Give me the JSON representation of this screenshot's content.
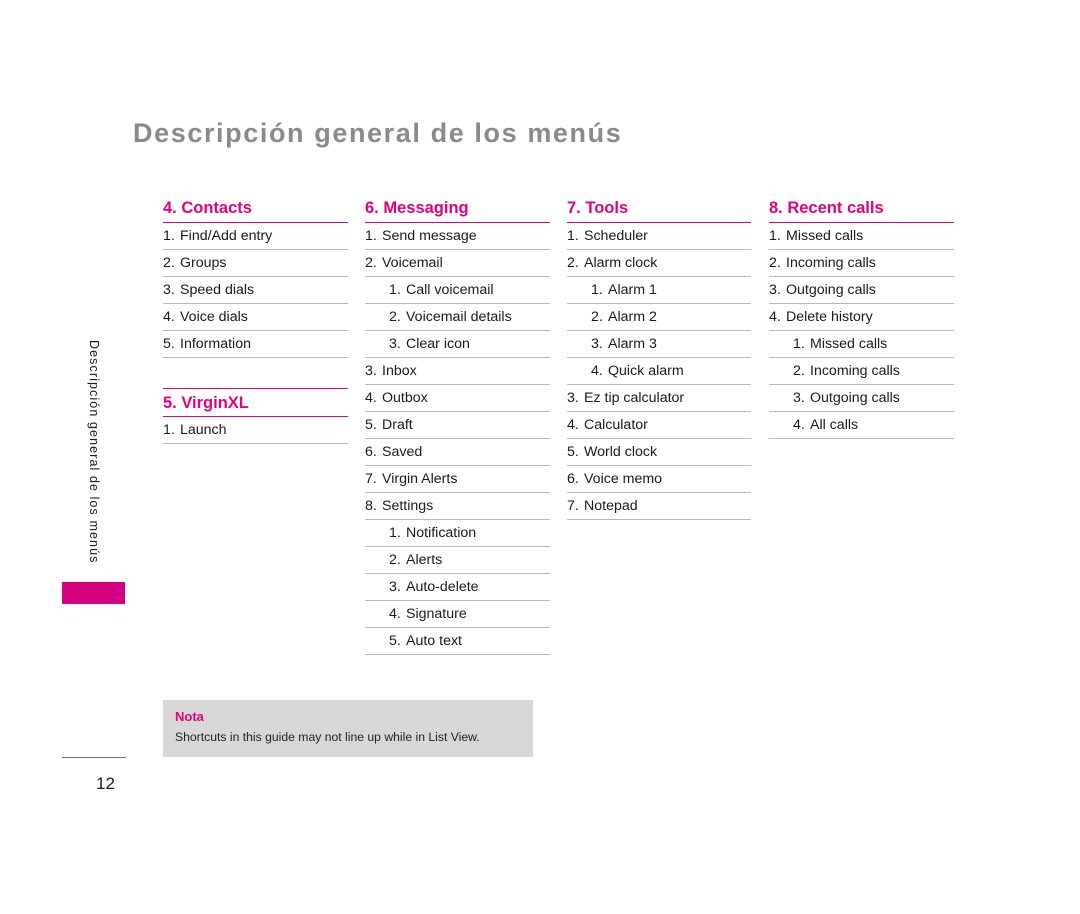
{
  "page": {
    "title": "Descripción general de los menús",
    "sidebar_label": "Descripción general de los menús",
    "page_number": "12",
    "accent_color": "#e4007f",
    "sidebar_block_color": "#d4007f",
    "title_color": "#8a8a8a",
    "rule_color": "#b9b9b9"
  },
  "columns": [
    {
      "sections": [
        {
          "heading": "4. Contacts",
          "top_rule": false,
          "items": [
            {
              "num": "1.",
              "text": "Find/Add entry",
              "level": 1
            },
            {
              "num": "2.",
              "text": "Groups",
              "level": 1
            },
            {
              "num": "3.",
              "text": "Speed dials",
              "level": 1
            },
            {
              "num": "4.",
              "text": "Voice dials",
              "level": 1
            },
            {
              "num": "5.",
              "text": "Information",
              "level": 1
            }
          ]
        },
        {
          "heading": "5. VirginXL",
          "top_rule": true,
          "items": [
            {
              "num": "1.",
              "text": "Launch",
              "level": 1
            }
          ]
        }
      ]
    },
    {
      "sections": [
        {
          "heading": "6. Messaging",
          "top_rule": false,
          "items": [
            {
              "num": "1.",
              "text": "Send message",
              "level": 1
            },
            {
              "num": "2.",
              "text": "Voicemail",
              "level": 1
            },
            {
              "num": "1.",
              "text": "Call voicemail",
              "level": 2
            },
            {
              "num": "2.",
              "text": "Voicemail details",
              "level": 2
            },
            {
              "num": "3.",
              "text": "Clear icon",
              "level": 2
            },
            {
              "num": "3.",
              "text": "Inbox",
              "level": 1
            },
            {
              "num": "4.",
              "text": "Outbox",
              "level": 1
            },
            {
              "num": "5.",
              "text": "Draft",
              "level": 1
            },
            {
              "num": "6.",
              "text": "Saved",
              "level": 1
            },
            {
              "num": "7.",
              "text": "Virgin Alerts",
              "level": 1
            },
            {
              "num": "8.",
              "text": "Settings",
              "level": 1
            },
            {
              "num": "1.",
              "text": "Notification",
              "level": 2
            },
            {
              "num": "2.",
              "text": "Alerts",
              "level": 2
            },
            {
              "num": "3.",
              "text": "Auto-delete",
              "level": 2
            },
            {
              "num": "4.",
              "text": "Signature",
              "level": 2
            },
            {
              "num": "5.",
              "text": "Auto text",
              "level": 2
            }
          ]
        }
      ]
    },
    {
      "sections": [
        {
          "heading": "7. Tools",
          "top_rule": false,
          "items": [
            {
              "num": "1.",
              "text": "Scheduler",
              "level": 1
            },
            {
              "num": "2.",
              "text": "Alarm clock",
              "level": 1
            },
            {
              "num": "1.",
              "text": "Alarm 1",
              "level": 2
            },
            {
              "num": "2.",
              "text": "Alarm 2",
              "level": 2
            },
            {
              "num": "3.",
              "text": "Alarm 3",
              "level": 2
            },
            {
              "num": "4.",
              "text": "Quick alarm",
              "level": 2
            },
            {
              "num": "3.",
              "text": "Ez tip calculator",
              "level": 1
            },
            {
              "num": "4.",
              "text": "Calculator",
              "level": 1
            },
            {
              "num": "5.",
              "text": "World clock",
              "level": 1
            },
            {
              "num": "6.",
              "text": "Voice memo",
              "level": 1
            },
            {
              "num": "7.",
              "text": "Notepad",
              "level": 1
            }
          ]
        }
      ]
    },
    {
      "sections": [
        {
          "heading": "8. Recent calls",
          "top_rule": false,
          "items": [
            {
              "num": "1.",
              "text": "Missed calls",
              "level": 1
            },
            {
              "num": "2.",
              "text": "Incoming calls",
              "level": 1
            },
            {
              "num": "3.",
              "text": "Outgoing calls",
              "level": 1
            },
            {
              "num": "4.",
              "text": "Delete history",
              "level": 1
            },
            {
              "num": "1.",
              "text": "Missed calls",
              "level": 2
            },
            {
              "num": "2.",
              "text": "Incoming calls",
              "level": 2
            },
            {
              "num": "3.",
              "text": "Outgoing calls",
              "level": 2
            },
            {
              "num": "4.",
              "text": "All calls",
              "level": 2
            }
          ]
        }
      ]
    }
  ],
  "nota": {
    "title": "Nota",
    "body": "Shortcuts in this guide may not line up while in List View."
  }
}
